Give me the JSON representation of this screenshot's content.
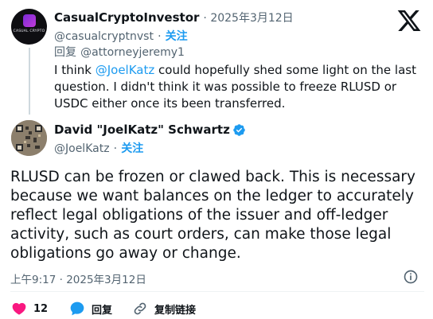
{
  "colors": {
    "accent": "#1d9bf0",
    "like": "#f91880",
    "verified": "#1d9bf0",
    "muted": "#536471"
  },
  "reply": {
    "avatar_text": "CASUAL CRYPTO",
    "name": "CasualCryptoInvestor",
    "date": "· 2025年3月12日",
    "handle": "@casualcryptnvst",
    "separator": "·",
    "follow": "关注",
    "reply_label": "回复",
    "reply_to": "@attorneyjeremy1",
    "text_prefix": "I think ",
    "mention": "@JoelKatz",
    "text_suffix": " could hopefully shed some light on the last question. I didn't think it was possible to freeze RLUSD or USDC either once its been transferred."
  },
  "main": {
    "name": "David \"JoelKatz\" Schwartz",
    "verified_icon": "verified-badge-icon",
    "handle": "@JoelKatz",
    "separator": "·",
    "follow": "关注",
    "text": "RLUSD can be frozen or clawed back. This is necessary because we want balances on the ledger to accurately reflect legal obligations of the issuer and off-ledger activity, such as court orders, can make those legal obligations go away or change.",
    "timestamp": "上午9:17 · 2025年3月12日"
  },
  "actions": {
    "like_count": "12",
    "reply_label": "回复",
    "copy_label": "复制链接"
  }
}
